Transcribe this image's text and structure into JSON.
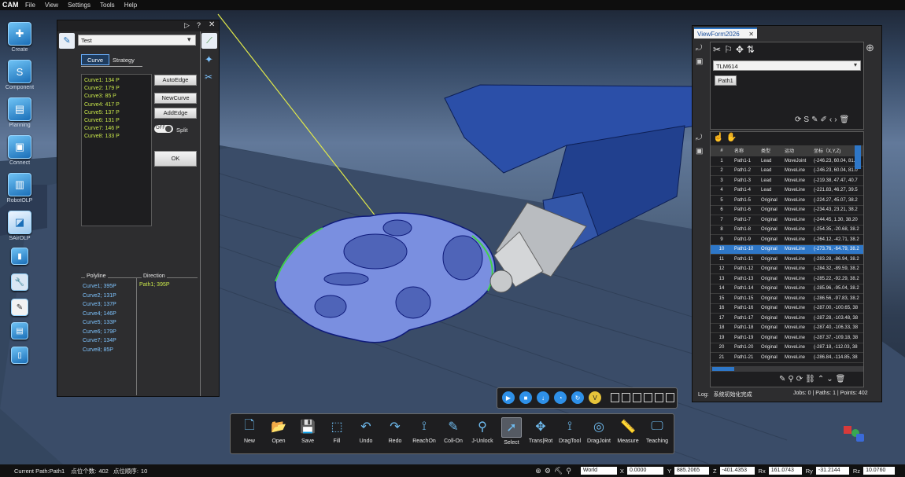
{
  "app": {
    "logo": "CAM"
  },
  "menu": [
    "File",
    "View",
    "Settings",
    "Tools",
    "Help"
  ],
  "left_toolbar": [
    {
      "label": "Create",
      "icon": "create-icon"
    },
    {
      "label": "Component",
      "icon": "component-icon"
    },
    {
      "label": "Planning",
      "icon": "planning-icon"
    },
    {
      "label": "Connect",
      "icon": "connect-icon"
    },
    {
      "label": "RobotOLP",
      "icon": "robot-olp-icon"
    },
    {
      "label": "SAirOLP",
      "icon": "sair-olp-icon"
    }
  ],
  "curve_panel": {
    "dropdown_value": "Test",
    "tabs": [
      "Curve",
      "Strategy"
    ],
    "curves": [
      "Curve1: 134 P",
      "Curve2: 179 P",
      "Curve3: 85 P",
      "Curve4: 417 P",
      "Curve5: 137 P",
      "Curve6: 131 P",
      "Curve7: 146 P",
      "Curve8: 133 P"
    ],
    "buttons": {
      "autoedge": "AutoEdge",
      "newcurve": "NewCurve",
      "addedge": "AddEdge",
      "ok": "OK"
    },
    "toggle": {
      "state": "OFF",
      "label": "Split"
    },
    "polyline_header": "Polyline",
    "direction_header": "Direction",
    "polylines": [
      "Curve1; 395P",
      "Curve2; 131P",
      "Curve3; 137P",
      "Curve4; 146P",
      "Curve5; 133P",
      "Curve6; 179P",
      "Curve7; 134P",
      "Curve8; 85P"
    ],
    "directions": [
      "Path1; 395P"
    ]
  },
  "viewform": {
    "tab": "ViewForm2026",
    "tool_select": "TLM614",
    "path_button": "Path1",
    "columns": [
      "#",
      "名称",
      "类型",
      "运动",
      "坐标（X,Y,Z)"
    ],
    "selected_row": 9,
    "rows": [
      [
        "1",
        "Path1-1",
        "Lead",
        "MoveJoint",
        "(-246.23, 60.04, 81.0"
      ],
      [
        "2",
        "Path1-2",
        "Lead",
        "MoveLine",
        "(-246.23, 60.04, 81.0"
      ],
      [
        "3",
        "Path1-3",
        "Lead",
        "MoveLine",
        "(-219.38, 47.47, 40.7"
      ],
      [
        "4",
        "Path1-4",
        "Lead",
        "MoveLine",
        "(-221.83, 46.27, 39.5"
      ],
      [
        "5",
        "Path1-5",
        "Original",
        "MoveLine",
        "(-224.27, 45.07, 38.2"
      ],
      [
        "6",
        "Path1-6",
        "Original",
        "MoveLine",
        "(-234.43, 23.21, 38.2"
      ],
      [
        "7",
        "Path1-7",
        "Original",
        "MoveLine",
        "(-244.45, 1.30, 38.20"
      ],
      [
        "8",
        "Path1-8",
        "Original",
        "MoveLine",
        "(-254.35, -20.68, 38.2"
      ],
      [
        "9",
        "Path1-9",
        "Original",
        "MoveLine",
        "(-264.12, -42.71, 38.2"
      ],
      [
        "10",
        "Path1-10",
        "Original",
        "MoveLine",
        "(-273.76, -64.79, 38.2"
      ],
      [
        "11",
        "Path1-11",
        "Original",
        "MoveLine",
        "(-283.28, -86.94, 38.2"
      ],
      [
        "12",
        "Path1-12",
        "Original",
        "MoveLine",
        "(-284.32, -89.59, 38.2"
      ],
      [
        "13",
        "Path1-13",
        "Original",
        "MoveLine",
        "(-285.22, -92.29, 38.2"
      ],
      [
        "14",
        "Path1-14",
        "Original",
        "MoveLine",
        "(-285.96, -95.04, 38.2"
      ],
      [
        "15",
        "Path1-15",
        "Original",
        "MoveLine",
        "(-286.56, -97.83, 38.2"
      ],
      [
        "16",
        "Path1-16",
        "Original",
        "MoveLine",
        "(-287.00, -100.65, 38"
      ],
      [
        "17",
        "Path1-17",
        "Original",
        "MoveLine",
        "(-287.28, -103.48, 38"
      ],
      [
        "18",
        "Path1-18",
        "Original",
        "MoveLine",
        "(-287.40, -106.33, 38"
      ],
      [
        "19",
        "Path1-19",
        "Original",
        "MoveLine",
        "(-287.37, -109.18, 38"
      ],
      [
        "20",
        "Path1-20",
        "Original",
        "MoveLine",
        "(-287.18, -112.03, 38"
      ],
      [
        "21",
        "Path1-21",
        "Original",
        "MoveLine",
        "(-286.84, -114.85, 38"
      ]
    ],
    "log_label": "Log:",
    "log_text": "系统初始化完成",
    "stats": "Jobs: 0 | Paths: 1 | Points: 402"
  },
  "bottom_toolbar": [
    {
      "label": "New",
      "icon": "new-file-icon",
      "glyph": "🗋"
    },
    {
      "label": "Open",
      "icon": "open-folder-icon",
      "glyph": "📂"
    },
    {
      "label": "Save",
      "icon": "save-icon",
      "glyph": "💾"
    },
    {
      "label": "Fill",
      "icon": "fill-icon",
      "glyph": "⬚"
    },
    {
      "label": "Undo",
      "icon": "undo-icon",
      "glyph": "↶"
    },
    {
      "label": "Redo",
      "icon": "redo-icon",
      "glyph": "↷"
    },
    {
      "label": "ReachOn",
      "icon": "reach-on-icon",
      "glyph": "⟟"
    },
    {
      "label": "Coll-On",
      "icon": "collision-on-icon",
      "glyph": "✎"
    },
    {
      "label": "J-Unlock",
      "icon": "joint-unlock-icon",
      "glyph": "⚲"
    },
    {
      "label": "Select",
      "icon": "select-cursor-icon",
      "glyph": "➚"
    },
    {
      "label": "Trans|Rot",
      "icon": "translate-rotate-icon",
      "glyph": "✥"
    },
    {
      "label": "DragTool",
      "icon": "drag-tool-icon",
      "glyph": "⟟"
    },
    {
      "label": "DragJoint",
      "icon": "drag-joint-icon",
      "glyph": "◎"
    },
    {
      "label": "Measure",
      "icon": "measure-ruler-icon",
      "glyph": "📏"
    },
    {
      "label": "Teaching",
      "icon": "teaching-icon",
      "glyph": "🖵"
    }
  ],
  "playback": {
    "selected_tool": "Select"
  },
  "status": {
    "path": "Current Path:Path1",
    "points_label": "点位个数",
    "points_value": "402",
    "order_label": "点位顺序",
    "order_value": "10",
    "frame": "World",
    "coords": [
      {
        "label": "X",
        "value": "0.0000"
      },
      {
        "label": "Y",
        "value": "885.2065"
      },
      {
        "label": "Z",
        "value": "-401.4353"
      },
      {
        "label": "Rx",
        "value": "161.0743"
      },
      {
        "label": "Ry",
        "value": "-31.2144"
      },
      {
        "label": "Rz",
        "value": "10.0760"
      }
    ]
  },
  "colors": {
    "accent": "#2e77c8",
    "curve": "#c8e64a",
    "part": "#6f86d8"
  }
}
